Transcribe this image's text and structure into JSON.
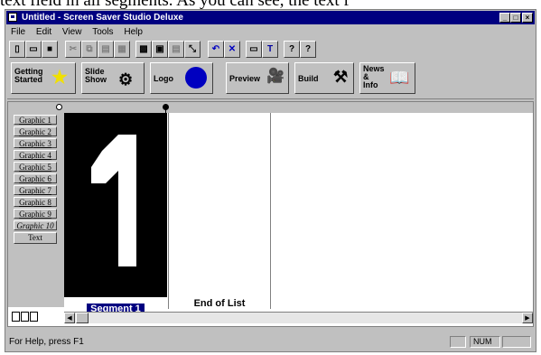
{
  "overlay_text": "text field in all segments. As you can see, the text f",
  "window": {
    "title": "Untitled - Screen Saver Studio Deluxe",
    "caption_buttons": [
      "minimize-icon",
      "maximize-icon",
      "close-icon"
    ]
  },
  "menu": [
    "File",
    "Edit",
    "View",
    "Tools",
    "Help"
  ],
  "toolbar": {
    "icons": [
      "new-icon",
      "open-icon",
      "save-icon",
      "cut-icon",
      "copy-icon",
      "paste-icon",
      "grid-icon",
      "image-icon",
      "frame-icon",
      "resize-icon",
      "undo-icon",
      "delete-icon",
      "monitor-icon",
      "text-icon",
      "help-icon",
      "context-help-icon"
    ],
    "text_button": "T",
    "help_button": "?",
    "context_help_button": "?"
  },
  "big_toolbar": {
    "getting_started": [
      "Getting",
      "Started"
    ],
    "slide_show": [
      "Slide",
      "Show"
    ],
    "logo": "Logo",
    "preview": "Preview",
    "build": "Build",
    "news": [
      "News",
      "&",
      "Info"
    ]
  },
  "sidebar": {
    "items": [
      "Graphic 1",
      "Graphic 2",
      "Graphic 3",
      "Graphic 4",
      "Graphic 5",
      "Graphic 6",
      "Graphic 7",
      "Graphic 8",
      "Graphic 9",
      "Graphic 10",
      "Text"
    ]
  },
  "segments": [
    {
      "label": "Segment 1",
      "content": "1"
    },
    {
      "label": "End of List"
    }
  ],
  "status": {
    "help": "For Help, press F1",
    "num": "NUM"
  },
  "colors": {
    "titlebar": "#000080",
    "face": "#c0c0c0",
    "selection": "#000080"
  }
}
